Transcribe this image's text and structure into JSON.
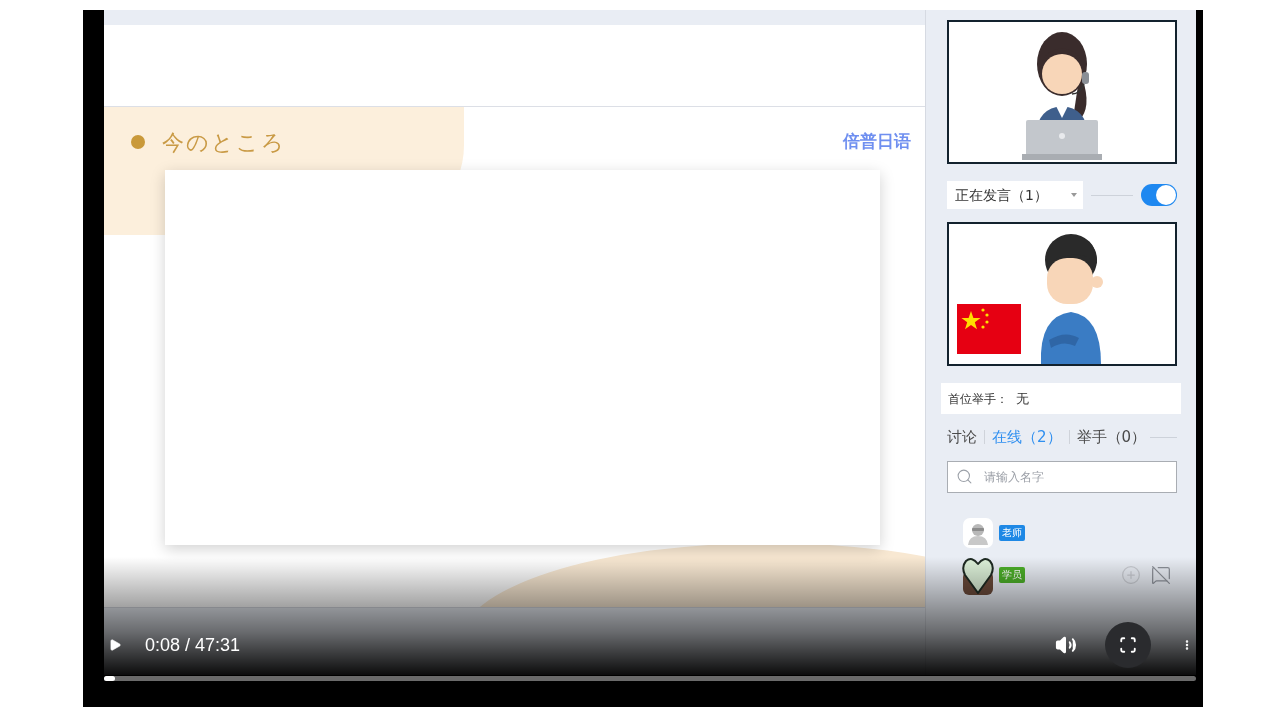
{
  "slide": {
    "title": "今のところ",
    "logo": "倍普日语"
  },
  "sidebar": {
    "speaking_dropdown": {
      "value": "正在发言（1）"
    },
    "video_toggle": {
      "on": true
    },
    "first_raised_hand": {
      "label": "首位举手：",
      "value": "无"
    },
    "tabs": [
      {
        "label": "讨论",
        "selected": false
      },
      {
        "label": "在线（2）",
        "selected": true
      },
      {
        "label": "举手（0）",
        "selected": false
      }
    ],
    "search": {
      "placeholder": "请输入名字"
    },
    "members": [
      {
        "kind": "teacher",
        "role": "老师",
        "color": "#1e88e5"
      },
      {
        "kind": "student",
        "role": "学员",
        "color": "#4caf28"
      }
    ]
  },
  "player": {
    "time": "0:08 / 47:31",
    "progress": {
      "level": 0.01
    }
  }
}
